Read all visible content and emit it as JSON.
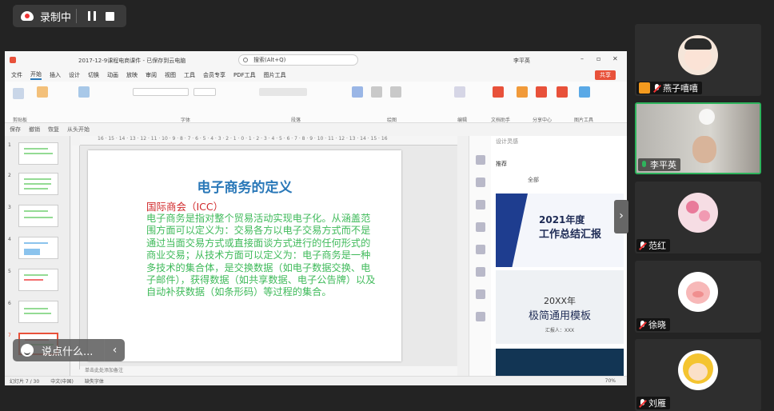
{
  "recording": {
    "label": "录制中"
  },
  "ppt": {
    "title": "2017-12-9课程电商课件 - 已保存到云电脑",
    "search_placeholder": "搜索(Alt+Q)",
    "user": "李平英",
    "menus": [
      "文件",
      "开始",
      "插入",
      "设计",
      "切换",
      "动画",
      "放映",
      "审阅",
      "视图",
      "工具",
      "会员专享",
      "PDF工具",
      "图片工具"
    ],
    "share": "共享",
    "groups": [
      "剪贴板",
      "字体",
      "段落",
      "绘图",
      "编辑",
      "文档助手",
      "分享中心",
      "图片工具"
    ],
    "quick": [
      "保存",
      "撤销",
      "恢复",
      "从头开始"
    ],
    "ruler_text": "16 · 15 · 14 · 13 · 12 · 11 · 10 · 9 · 8 · 7 · 6 · 5 · 4 · 3 · 2 · 1 · 0 · 1 · 2 · 3 · 4 · 5 · 6 · 7 · 8 · 9 · 10 · 11 · 12 · 13 · 14 · 15 · 16",
    "slide_numbers": [
      "1",
      "2",
      "3",
      "4",
      "5",
      "6",
      "7"
    ],
    "slide": {
      "title": "电子商务的定义",
      "subtitle": "国际商会（ICC）",
      "body": "电子商务是指对整个贸易活动实现电子化。从涵盖范围方面可以定义为：交易各方以电子交易方式而不是通过当面交易方式或直接面谈方式进行的任何形式的商业交易；从技术方面可以定义为：电子商务是一种多技术的集合体，是交换数据（如电子数据交换、电子邮件），获得数据（如共享数据、电子公告牌）以及自动补获数据（如条形码）等过程的集合。"
    },
    "notes": "单击此处添加备注",
    "status": [
      "幻灯片 7 / 30",
      "中文(中国)",
      "缺失字体"
    ],
    "zoom": "70%",
    "panel": {
      "header": "设计灵感",
      "tabs": [
        "推荐",
        "全部"
      ],
      "tpl1_title": "2021年度",
      "tpl1_sub": "工作总结汇报",
      "tpl2_title": "20XX年",
      "tpl2_sub": "极简通用模板",
      "tpl2_name": "汇报人：XXX"
    }
  },
  "chat": {
    "placeholder": "说点什么..."
  },
  "participants": [
    {
      "name": "燕子嘻嘻",
      "muted": true,
      "host": true
    },
    {
      "name": "李平英",
      "muted": false,
      "host": false
    },
    {
      "name": "范红",
      "muted": true,
      "host": false
    },
    {
      "name": "徐晓",
      "muted": true,
      "host": false
    },
    {
      "name": "刘雁",
      "muted": true,
      "host": false
    }
  ],
  "colors": {
    "accent_green": "#2eb35c",
    "slide_title": "#2a78b8",
    "slide_sub": "#d0282a",
    "slide_body": "#3fba5a",
    "share": "#e8513a"
  }
}
